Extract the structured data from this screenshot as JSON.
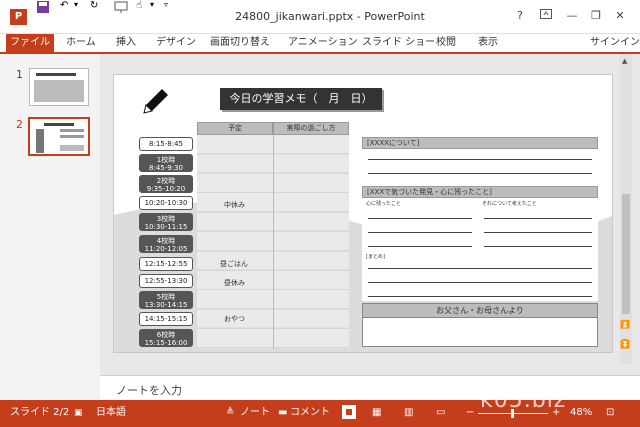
{
  "titlebar": {
    "app_icon": "P",
    "title": "24800_jikanwari.pptx - PowerPoint",
    "help": "?",
    "signin": "サインイン"
  },
  "ribbon": {
    "file": "ファイル",
    "tabs": [
      "ホーム",
      "挿入",
      "デザイン",
      "画面切り替え",
      "アニメーション",
      "スライド ショー",
      "校閲",
      "表示"
    ]
  },
  "thumbnails": {
    "slide1_num": "1",
    "slide2_num": "2"
  },
  "slide": {
    "title": "今日の学習メモ（　月　日）",
    "col_yotei": "予定",
    "col_jissai": "実際の過ごし方",
    "times": [
      {
        "line1": "8:15-8:45",
        "line2": ""
      },
      {
        "line1": "1校時",
        "line2": "8:45-9:30"
      },
      {
        "line1": "2校時",
        "line2": "9:35-10:20"
      },
      {
        "line1": "10:20-10:30",
        "line2": ""
      },
      {
        "line1": "3校時",
        "line2": "10:30-11:15"
      },
      {
        "line1": "4校時",
        "line2": "11:20-12:05"
      },
      {
        "line1": "12:15-12:55",
        "line2": ""
      },
      {
        "line1": "12:55-13:30",
        "line2": ""
      },
      {
        "line1": "5校時",
        "line2": "13:30-14:15"
      },
      {
        "line1": "14:15-15:15",
        "line2": ""
      },
      {
        "line1": "6校時",
        "line2": "15:15-16:00"
      }
    ],
    "plans": {
      "chukyumi": "中休み",
      "hirugohan": "昼ごはん",
      "hirukyumi": "昼休み",
      "oyatsu": "おやつ"
    },
    "about": "[XXXXについて]",
    "noticed": "[XXXで気づいた発見・心に残ったこと]",
    "sub1": "心に残ったこと",
    "sub2": "それについて考えたこと",
    "matome": "[まとめ]",
    "parents": "お父さん・お母さんより"
  },
  "notes": {
    "placeholder": "ノートを入力"
  },
  "status": {
    "slide": "スライド 2/2",
    "lang": "日本語",
    "notes": "ノート",
    "comments": "コメント",
    "zoom": "48%"
  },
  "watermark": "k05.biz",
  "colors": {
    "accent": "#c43e1c",
    "header_bar": "#bcbcbc",
    "dark_box": "#555555"
  }
}
